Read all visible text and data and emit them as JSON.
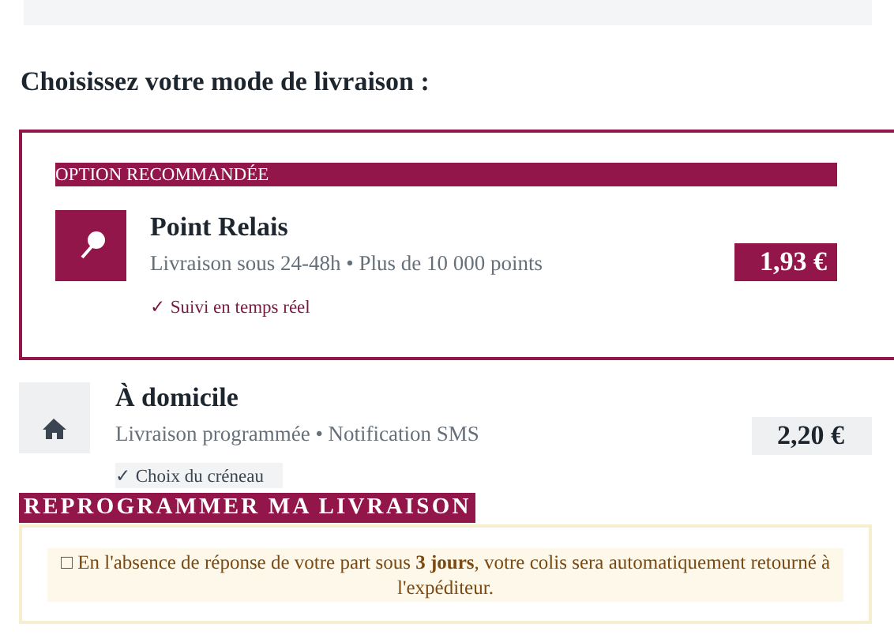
{
  "heading": "Choisissez votre mode de livraison :",
  "options": [
    {
      "kind": "relay",
      "recommended": true,
      "badge": "OPTION RECOMMANDÉE",
      "title": "Point Relais",
      "subtitle": "Livraison sous 24-48h • Plus de 10 000 points",
      "price": "1,93 €",
      "feature": "✓ Suivi en temps réel"
    },
    {
      "kind": "home",
      "recommended": false,
      "title": "À domicile",
      "subtitle": "Livraison programmée • Notification SMS",
      "price": "2,20 €",
      "feature": "✓ Choix du créneau"
    }
  ],
  "reschedule_button": "REPROGRAMMER MA LIVRAISON",
  "notice": {
    "icon": "□",
    "text": "En l'absence de réponse de votre part sous **3 jours**, votre colis sera automatiquement retourné à l'expéditeur."
  }
}
